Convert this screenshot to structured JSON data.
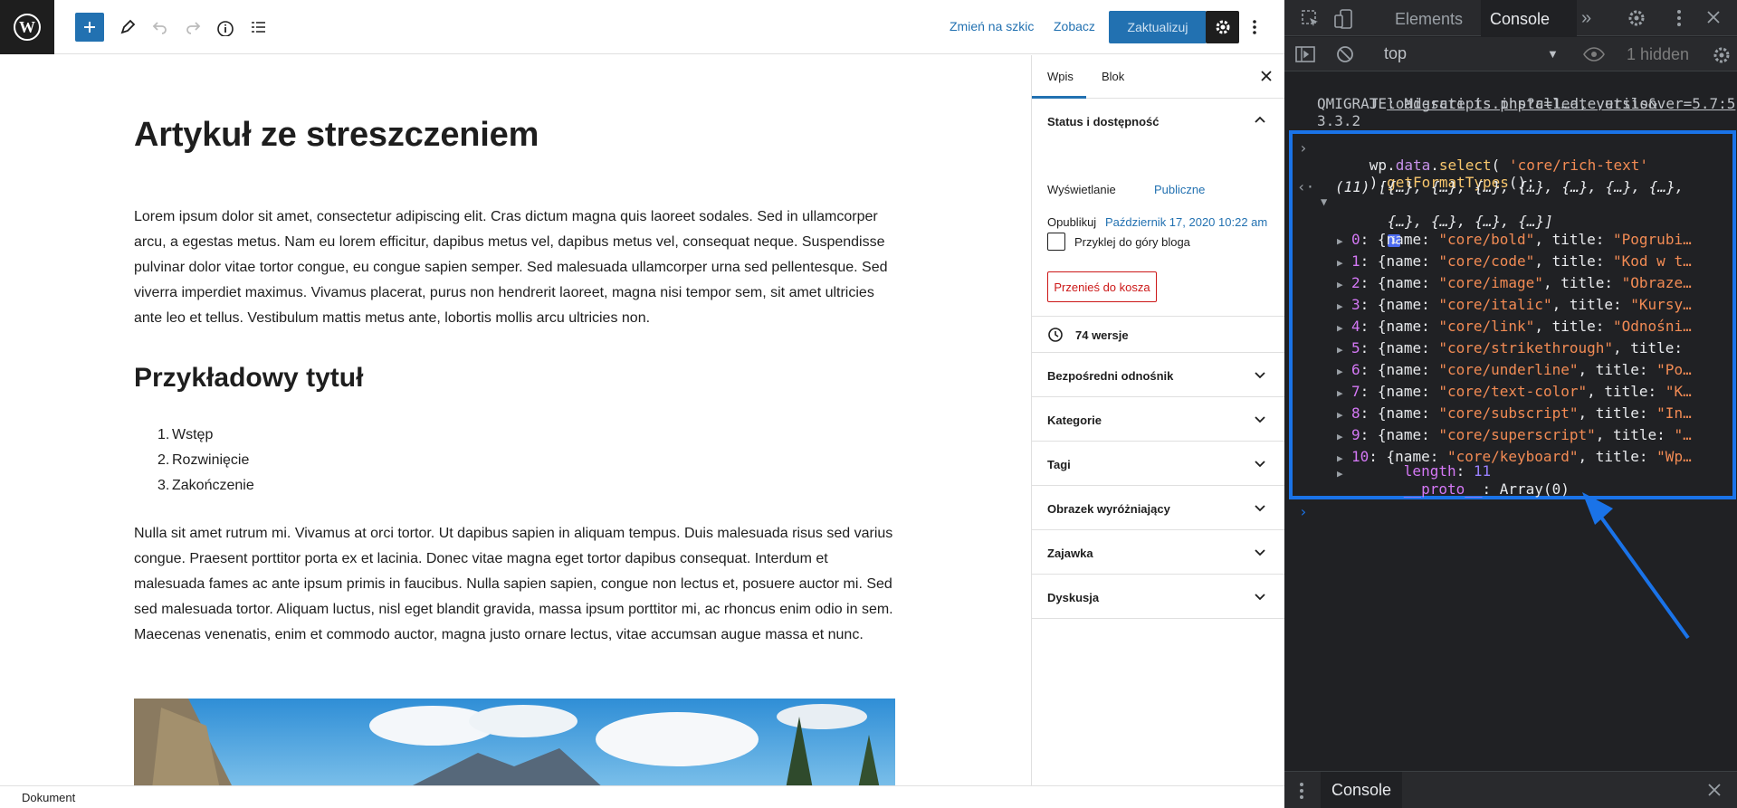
{
  "topbar": {
    "switch_to_draft": "Zmień na szkic",
    "preview": "Zobacz",
    "update": "Zaktualizuj"
  },
  "post": {
    "title": "Artykuł ze streszczeniem",
    "para1": "Lorem ipsum dolor sit amet, consectetur adipiscing elit. Cras dictum magna quis laoreet sodales. Sed in ullamcorper arcu, a egestas metus. Nam eu lorem efficitur, dapibus metus vel, dapibus metus vel, consequat neque. Suspendisse pulvinar dolor vitae tortor congue, eu congue sapien semper. Sed malesuada ullamcorper urna sed pellentesque. Sed viverra imperdiet maximus. Vivamus placerat, purus non hendrerit laoreet, magna nisi tempor sem, sit amet ultricies ante leo et tellus. Vestibulum mattis metus ante, lobortis mollis arcu ultricies non.",
    "heading": "Przykładowy tytuł",
    "list": [
      "Wstęp",
      "Rozwinięcie",
      "Zakończenie"
    ],
    "para2": "Nulla sit amet rutrum mi. Vivamus at orci tortor. Ut dapibus sapien in aliquam tempus. Duis malesuada risus sed varius congue. Praesent porttitor porta ex et lacinia. Donec vitae magna eget tortor dapibus consequat. Interdum et malesuada fames ac ante ipsum primis in faucibus. Nulla sapien sapien, congue non lectus et, posuere auctor mi. Sed sed malesuada tortor. Aliquam luctus, nisl eget blandit gravida, massa ipsum porttitor mi, ac rhoncus enim odio in sem. Maecenas venenatis, enim et commodo auctor, magna justo ornare lectus, vitae accumsan augue massa et nunc."
  },
  "sidebar": {
    "tab_post": "Wpis",
    "tab_block": "Blok",
    "status_panel": "Status i dostępność",
    "visibility_label": "Wyświetlanie",
    "visibility_value": "Publiczne",
    "publish_label": "Opublikuj",
    "publish_value": "Październik 17, 2020 10:22 am",
    "sticky_label": "Przyklej do góry bloga",
    "trash": "Przenieś do kosza",
    "revisions": "74 wersje",
    "panels": [
      "Bezpośredni odnośnik",
      "Kategorie",
      "Tagi",
      "Obrazek wyróżniający",
      "Zajawka",
      "Dyskusja"
    ]
  },
  "footer": {
    "breadcrumb": "Dokument"
  },
  "devtools": {
    "tab_elements": "Elements",
    "tab_console": "Console",
    "context": "top",
    "hidden": "1 hidden",
    "drawer_tab": "Console",
    "log_source": "load-scripts.php?c=1…ate,utils&ver=5.7:5",
    "log_line1": "QMIGRATE: Migrate is installed, version",
    "log_line2": "3.3.2",
    "input_line1": "wp.data.select( 'core/rich-text'",
    "input_line2": ").getFormatTypes();",
    "result_line1": "(11) [{…}, {…}, {…}, {…}, {…}, {…}, {…},",
    "result_line2": "{…}, {…}, {…}, {…}]",
    "items": [
      {
        "idx": "0",
        "name": "\"core/bold\"",
        "title": "\"Pogrubi…"
      },
      {
        "idx": "1",
        "name": "\"core/code\"",
        "title": "\"Kod w t…"
      },
      {
        "idx": "2",
        "name": "\"core/image\"",
        "title": "\"Obraze…"
      },
      {
        "idx": "3",
        "name": "\"core/italic\"",
        "title": "\"Kursy…"
      },
      {
        "idx": "4",
        "name": "\"core/link\"",
        "title": "\"Odnośni…"
      },
      {
        "idx": "5",
        "name": "\"core/strikethrough\"",
        "title": ""
      },
      {
        "idx": "6",
        "name": "\"core/underline\"",
        "title": "\"Po…"
      },
      {
        "idx": "7",
        "name": "\"core/text-color\"",
        "title": "\"K…"
      },
      {
        "idx": "8",
        "name": "\"core/subscript\"",
        "title": "\"In…"
      },
      {
        "idx": "9",
        "name": "\"core/superscript\"",
        "title": "\"…"
      },
      {
        "idx": "10",
        "name": "\"core/keyboard\"",
        "title": "\"Wp…"
      }
    ],
    "length_label": "length",
    "length_value": "11",
    "proto_label": "__proto__",
    "proto_value": "Array(0)"
  },
  "colors": {
    "accent": "#2271b1",
    "highlight": "#1a73e8",
    "danger": "#cc1818"
  }
}
